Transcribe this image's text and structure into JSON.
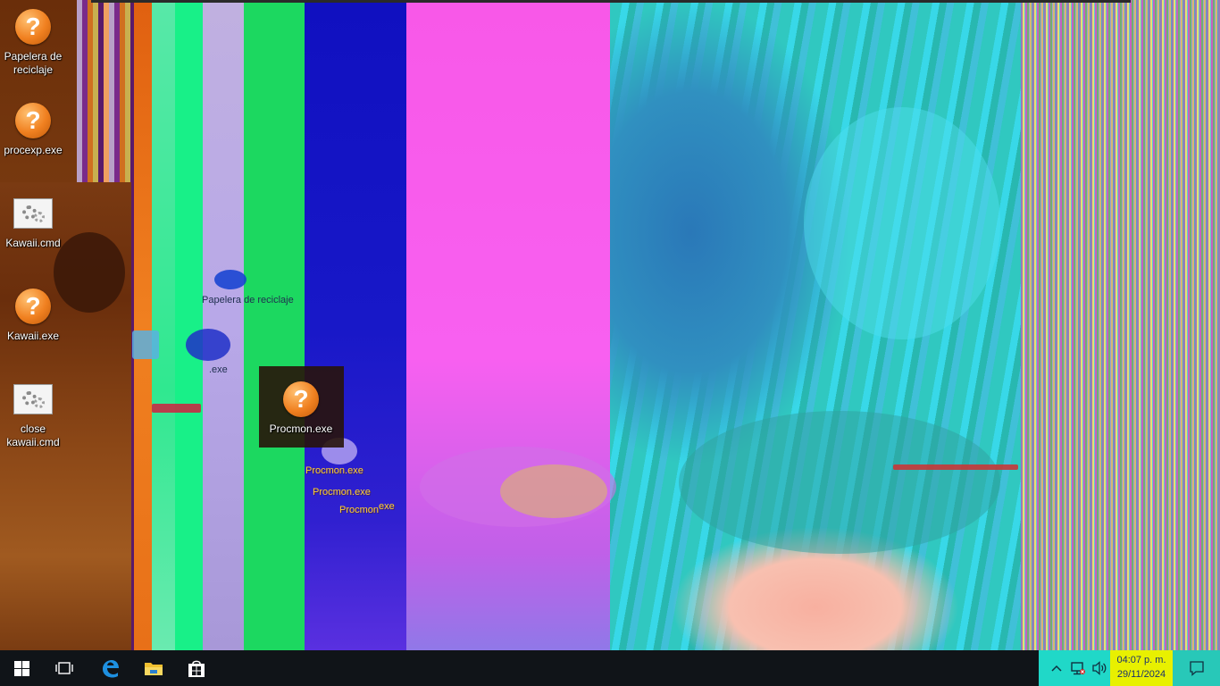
{
  "desktop": {
    "icons": [
      {
        "label": "Papelera de reciclaje",
        "icon": "unknown-file-icon"
      },
      {
        "label": "procexp.exe",
        "icon": "unknown-file-icon"
      },
      {
        "label": "Kawaii.cmd",
        "icon": "cmd-script-icon"
      },
      {
        "label": "Kawaii.exe",
        "icon": "unknown-file-icon"
      },
      {
        "label": "close kawaii.cmd",
        "icon": "cmd-script-icon"
      },
      {
        "label": "Procmon.exe",
        "icon": "unknown-file-icon"
      }
    ],
    "ghost_labels": [
      "Papelera de reciclaje",
      ".exe",
      "Procmon.exe",
      "Procmon.exe",
      "Procmon",
      "exe"
    ]
  },
  "taskbar": {
    "start_icon": "windows-logo-icon",
    "task_view_icon": "task-view-icon",
    "edge_icon": "edge-browser-icon",
    "explorer_icon": "folder-icon",
    "store_icon": "store-icon",
    "tray": {
      "chevron_icon": "chevron-up-icon",
      "network_icon": "network-icon",
      "volume_icon": "volume-icon"
    },
    "clock": {
      "time": "04:07 p. m.",
      "date": "29/11/2024"
    },
    "action_center_icon": "notification-icon"
  },
  "colors": {
    "taskbar": "#101418",
    "tray": "#20d8c8",
    "clock_bg": "#e8f000",
    "icon_orange": "#f08020",
    "edge_blue": "#1e90e0",
    "folder_yellow": "#f0c030"
  }
}
